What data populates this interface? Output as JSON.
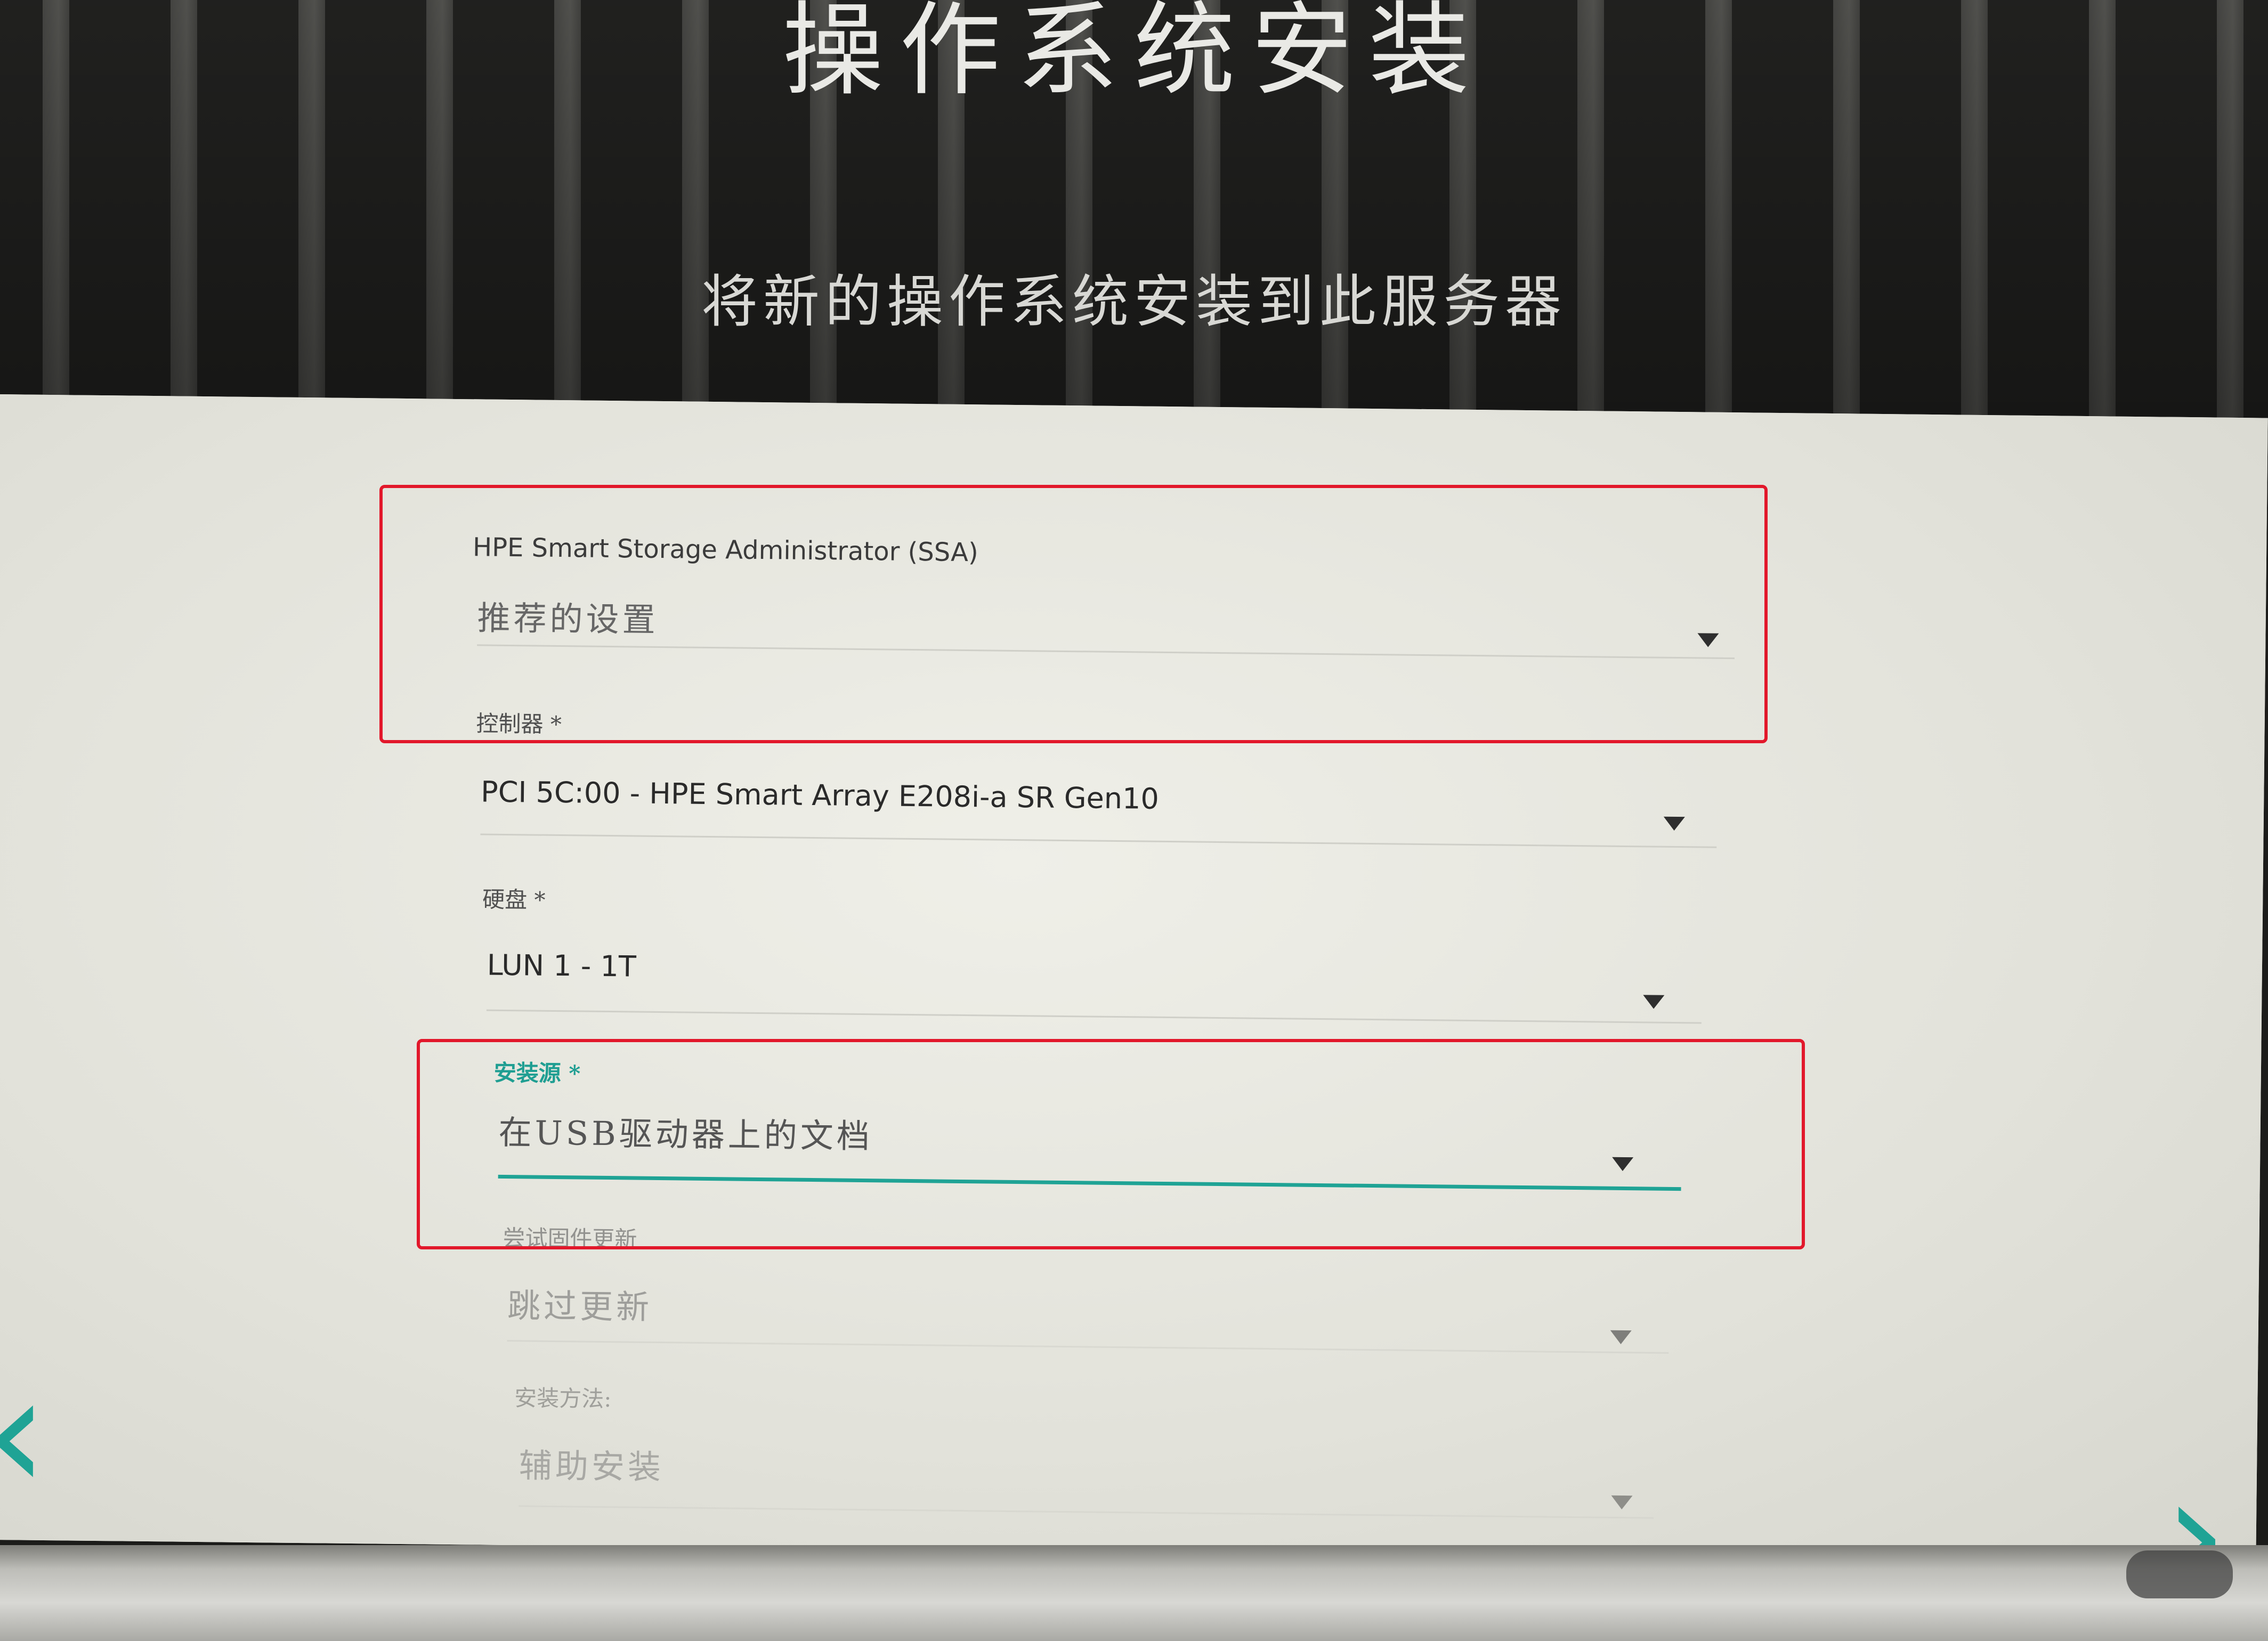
{
  "hero": {
    "title": "操作系统安装",
    "subtitle": "将新的操作系统安装到此服务器"
  },
  "form": {
    "ssa": {
      "label": "HPE Smart Storage Administrator (SSA)",
      "value": "推荐的设置"
    },
    "controller": {
      "label": "控制器 *",
      "value": "PCI 5C:00 - HPE Smart Array E208i-a SR Gen10"
    },
    "disk": {
      "label": "硬盘 *",
      "value": "LUN 1 - 1T"
    },
    "install_source": {
      "label": "安装源 *",
      "value": "在USB驱动器上的文档"
    },
    "firmware_update": {
      "label": "尝试固件更新",
      "value": "跳过更新"
    },
    "install_method": {
      "label": "安装方法:",
      "value": "辅助安装"
    }
  },
  "colors": {
    "accent": "#1fa395",
    "highlight": "#e2182b",
    "panel": "#e6e6de",
    "hero": "#262624"
  },
  "icons": {
    "dropdown": "chevron-down-icon",
    "back": "chevron-left-icon",
    "next": "chevron-right-icon"
  }
}
